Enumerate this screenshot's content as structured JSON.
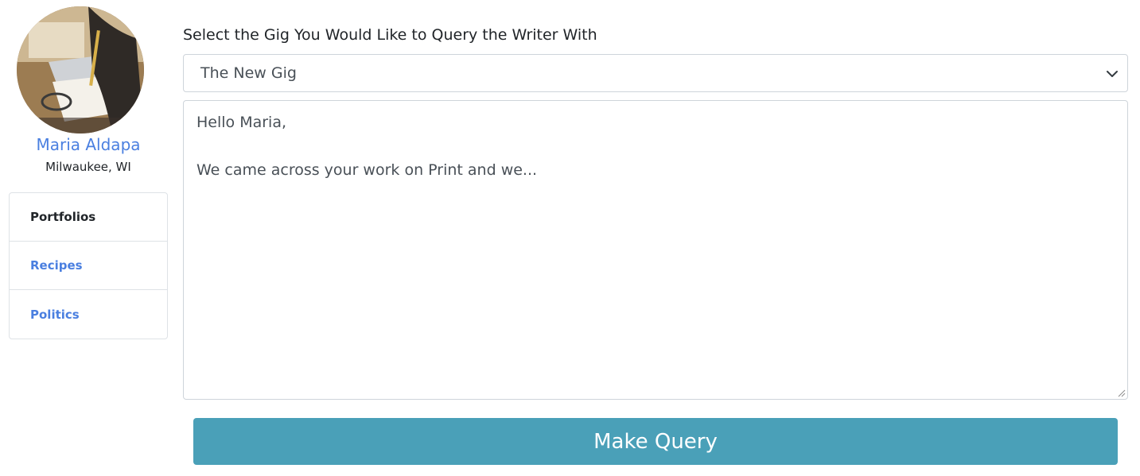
{
  "profile": {
    "name": "Maria Aldapa",
    "location": "Milwaukee, WI"
  },
  "portfolios": {
    "header": "Portfolios",
    "items": [
      {
        "label": "Recipes"
      },
      {
        "label": "Politics"
      }
    ]
  },
  "query_form": {
    "select_label": "Select the Gig You Would Like to Query the Writer With",
    "selected_gig": "The New Gig",
    "message_lines": [
      "Hello Maria,",
      "",
      "We came across your work on Print and we..."
    ],
    "submit_label": "Make Query"
  },
  "colors": {
    "link": "#4a7fe0",
    "button": "#4aa0b8"
  }
}
